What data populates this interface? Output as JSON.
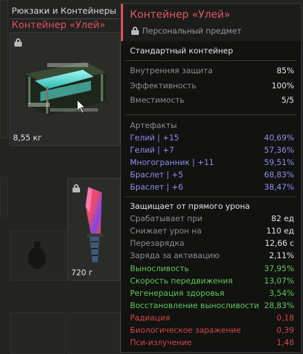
{
  "inventory": {
    "category_title": "Рюкзаки и Контейнеры",
    "selected_item_name": "Контейнер «Улей»",
    "main_item_weight": "8,55 кг",
    "knife_weight": "720 г"
  },
  "tooltip": {
    "title": "Контейнер «Улей»",
    "personal_label": "Персональный предмет",
    "item_type": "Стандартный контейнер",
    "base_stats": [
      {
        "label": "Внутренняя защита",
        "value": "85%"
      },
      {
        "label": "Эффективность",
        "value": "100%"
      },
      {
        "label": "Вместимость",
        "value": "5/5"
      }
    ],
    "artifacts_header": "Артефакты",
    "artifacts": [
      {
        "label": "Гелий | +15",
        "value": "40,69%"
      },
      {
        "label": "Гелий | +7",
        "value": "57,36%"
      },
      {
        "label": "Многогранник | +11",
        "value": "59,51%"
      },
      {
        "label": "Браслет | +5",
        "value": "68,83%"
      },
      {
        "label": "Браслет | +6",
        "value": "38,47%"
      }
    ],
    "protection_header": "Защищает от прямого урона",
    "protection_stats": [
      {
        "label": "Срабатывает при",
        "value": "82 ед"
      },
      {
        "label": "Снижает урон на",
        "value": "110 ед"
      },
      {
        "label": "Перезарядка",
        "value": "12,66 с"
      },
      {
        "label": "Заряда за активацию",
        "value": "2,11%"
      }
    ],
    "positive_effects": [
      {
        "label": "Выносливость",
        "value": "37,95%"
      },
      {
        "label": "Скорость передвижения",
        "value": "13,07%"
      },
      {
        "label": "Регенерация здоровья",
        "value": "3,54%"
      },
      {
        "label": "Восстановление выносливости",
        "value": "28,83%"
      }
    ],
    "negative_effects": [
      {
        "label": "Радиация",
        "value": "0,18"
      },
      {
        "label": "Биологическое заражение",
        "value": "0,39"
      },
      {
        "label": "Пси-излучение",
        "value": "1,48"
      }
    ]
  },
  "colors": {
    "accent_red": "#e0505a",
    "artifact_blue": "#8f8ff0",
    "effect_green": "#5ec85a",
    "effect_red": "#d24848"
  },
  "icons": [
    "lock-icon",
    "container-icon",
    "knife-icon",
    "grenade-icon",
    "cursor-icon"
  ]
}
